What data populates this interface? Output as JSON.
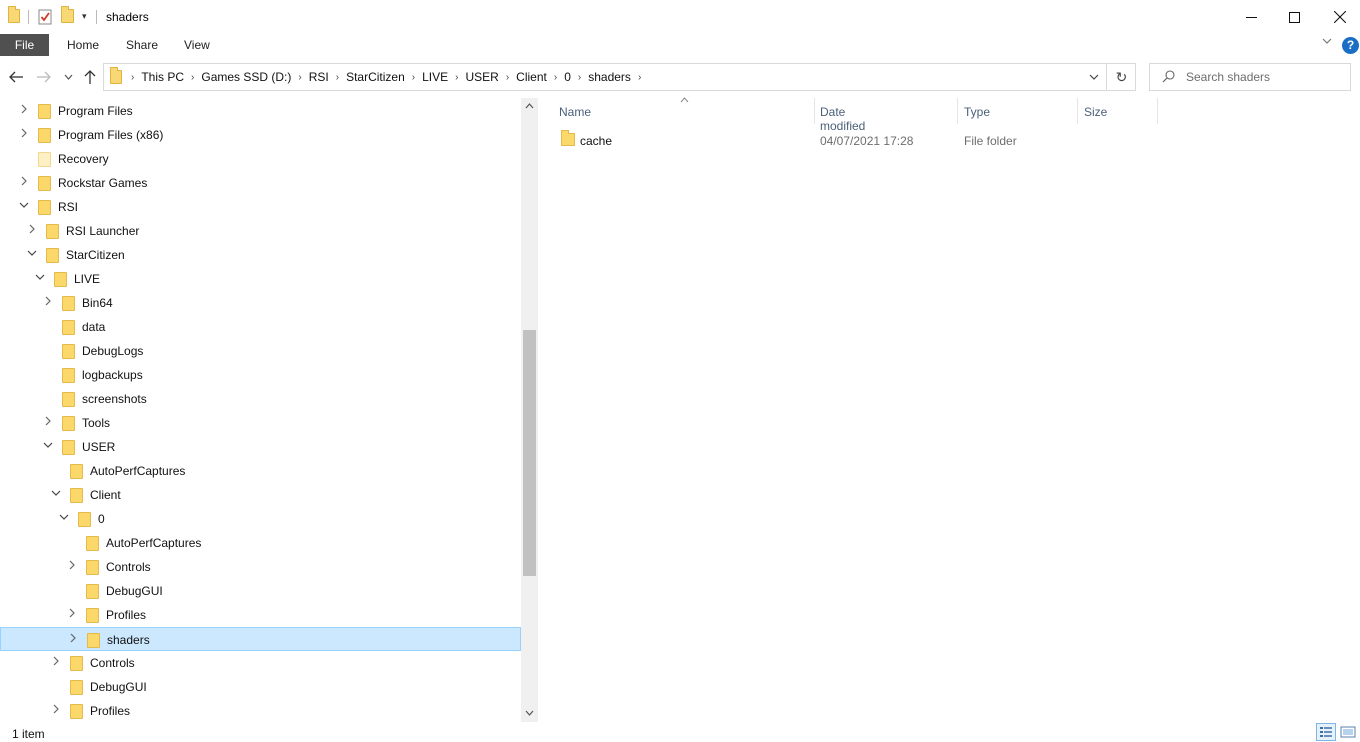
{
  "window": {
    "title": "shaders",
    "minimize_glyph": "—",
    "maximize_glyph": "☐",
    "close_glyph": "✕"
  },
  "ribbon": {
    "tabs": [
      "File",
      "Home",
      "Share",
      "View"
    ],
    "help_glyph": "?",
    "collapse_glyph": "﹀"
  },
  "nav": {
    "back_glyph": "←",
    "forward_glyph": "→",
    "recent_glyph": "⌄",
    "up_glyph": "↑",
    "breadcrumbs": [
      "This PC",
      "Games SSD (D:)",
      "RSI",
      "StarCitizen",
      "LIVE",
      "USER",
      "Client",
      "0",
      "shaders"
    ],
    "refresh_glyph": "↻",
    "dropdown_glyph": "⌄"
  },
  "search": {
    "placeholder": "Search shaders",
    "glyph": "⌕"
  },
  "tree": [
    {
      "label": "Program Files",
      "depth": 0,
      "expander": "collapsed",
      "style": "normal"
    },
    {
      "label": "Program Files (x86)",
      "depth": 0,
      "expander": "collapsed",
      "style": "normal"
    },
    {
      "label": "Recovery",
      "depth": 0,
      "expander": "none",
      "style": "light"
    },
    {
      "label": "Rockstar Games",
      "depth": 0,
      "expander": "collapsed",
      "style": "normal"
    },
    {
      "label": "RSI",
      "depth": 0,
      "expander": "expanded",
      "style": "normal"
    },
    {
      "label": "RSI Launcher",
      "depth": 1,
      "expander": "collapsed",
      "style": "normal"
    },
    {
      "label": "StarCitizen",
      "depth": 1,
      "expander": "expanded",
      "style": "normal"
    },
    {
      "label": "LIVE",
      "depth": 2,
      "expander": "expanded",
      "style": "normal"
    },
    {
      "label": "Bin64",
      "depth": 3,
      "expander": "collapsed",
      "style": "normal"
    },
    {
      "label": "data",
      "depth": 3,
      "expander": "none",
      "style": "normal"
    },
    {
      "label": "DebugLogs",
      "depth": 3,
      "expander": "none",
      "style": "normal"
    },
    {
      "label": "logbackups",
      "depth": 3,
      "expander": "none",
      "style": "normal"
    },
    {
      "label": "screenshots",
      "depth": 3,
      "expander": "none",
      "style": "normal"
    },
    {
      "label": "Tools",
      "depth": 3,
      "expander": "collapsed",
      "style": "normal"
    },
    {
      "label": "USER",
      "depth": 3,
      "expander": "expanded",
      "style": "normal"
    },
    {
      "label": "AutoPerfCaptures",
      "depth": 4,
      "expander": "none",
      "style": "normal"
    },
    {
      "label": "Client",
      "depth": 4,
      "expander": "expanded",
      "style": "normal"
    },
    {
      "label": "0",
      "depth": 5,
      "expander": "expanded",
      "style": "normal"
    },
    {
      "label": "AutoPerfCaptures",
      "depth": 6,
      "expander": "none",
      "style": "normal"
    },
    {
      "label": "Controls",
      "depth": 6,
      "expander": "collapsed",
      "style": "normal"
    },
    {
      "label": "DebugGUI",
      "depth": 6,
      "expander": "none",
      "style": "normal"
    },
    {
      "label": "Profiles",
      "depth": 6,
      "expander": "collapsed",
      "style": "normal"
    },
    {
      "label": "shaders",
      "depth": 6,
      "expander": "collapsed",
      "style": "normal",
      "selected": true
    },
    {
      "label": "Controls",
      "depth": 4,
      "expander": "collapsed",
      "style": "normal"
    },
    {
      "label": "DebugGUI",
      "depth": 4,
      "expander": "none",
      "style": "normal"
    },
    {
      "label": "Profiles",
      "depth": 4,
      "expander": "collapsed",
      "style": "normal"
    }
  ],
  "columns": {
    "name": "Name",
    "date": "Date modified",
    "type": "Type",
    "size": "Size",
    "sort_glyph": "^"
  },
  "files": [
    {
      "name": "cache",
      "date": "04/07/2021 17:28",
      "type": "File folder",
      "size": ""
    }
  ],
  "status": {
    "item_count": "1 item"
  },
  "colors": {
    "selection_bg": "#cce8ff",
    "selection_border": "#99d1ff",
    "folder_yellow": "#fbd86a",
    "file_tab_bg": "#505050",
    "column_header_text": "#4c607a",
    "help_blue": "#1a6fc4"
  }
}
